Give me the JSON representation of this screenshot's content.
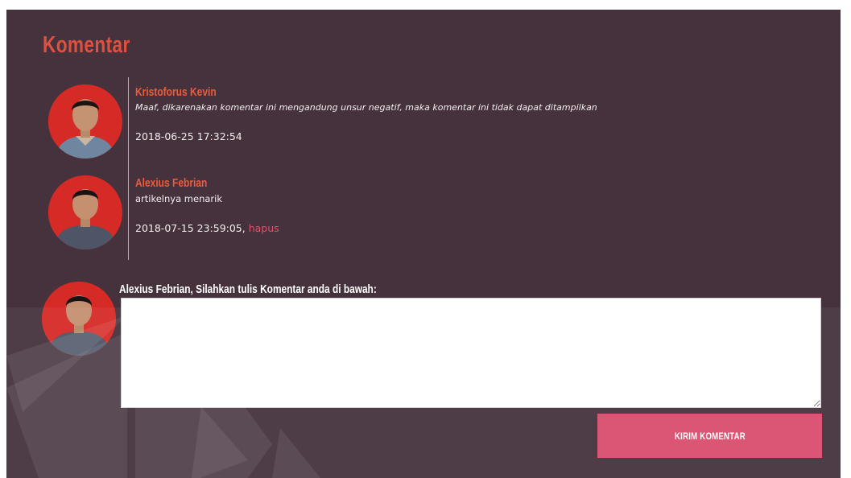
{
  "section": {
    "title": "Komentar"
  },
  "comments": [
    {
      "author": "Kristoforus Kevin",
      "text": "Maaf, dikarenakan komentar ini mengandung unsur negatif, maka komentar ini tidak dapat ditampilkan",
      "timestamp": "2018-06-25 17:32:54"
    },
    {
      "author": "Alexius Febrian",
      "text": "artikelnya menarik",
      "timestamp": "2018-07-15 23:59:05,",
      "delete_label": "hapus"
    }
  ],
  "form": {
    "prompt": "Alexius Febrian, Silahkan tulis Komentar anda di bawah:",
    "textarea_value": "",
    "submit_label": "KIRIM KOMENTAR"
  },
  "colors": {
    "panel_background": "#45323d",
    "title": "#e0503e",
    "author_name": "#ef5a3c",
    "delete_link": "#e0506a",
    "submit_button": "#d94d6d",
    "avatar_background": "#d62a26"
  },
  "icons": {
    "avatar": "user-photo-avatar",
    "watermark": "logo-watermark"
  }
}
